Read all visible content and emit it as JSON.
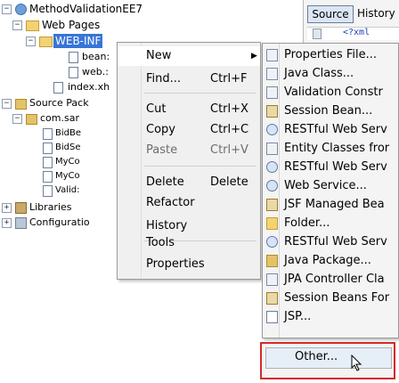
{
  "tree": {
    "project": "MethodValidationEE7",
    "web_pages": "Web Pages",
    "web_inf": "WEB-INF",
    "bean": "bean:",
    "web": "web.:",
    "index": "index.xh",
    "source_packages": "Source Pack",
    "com_package": "com.sar",
    "files": [
      "BidBe",
      "BidSe",
      "MyCo",
      "MyCo",
      "Valid:"
    ],
    "libraries": "Libraries",
    "configuration": "Configuratio"
  },
  "editor": {
    "tab_source": "Source",
    "tab_history": "History",
    "code_snippet": "<?xml"
  },
  "context_menu": {
    "items": [
      {
        "label": "New",
        "shortcut": "",
        "state": "highlighted",
        "submenu": true
      },
      {
        "label": "Find...",
        "shortcut": "Ctrl+F",
        "state": "normal"
      },
      {
        "label": "Cut",
        "shortcut": "Ctrl+X",
        "state": "normal"
      },
      {
        "label": "Copy",
        "shortcut": "Ctrl+C",
        "state": "normal"
      },
      {
        "label": "Paste",
        "shortcut": "Ctrl+V",
        "state": "disabled"
      },
      {
        "label": "Delete",
        "shortcut": "Delete",
        "state": "normal"
      },
      {
        "label": "Refactor",
        "shortcut": "",
        "state": "normal",
        "submenu": true
      },
      {
        "label": "History",
        "shortcut": "",
        "state": "normal",
        "submenu": true
      },
      {
        "label": "Tools",
        "shortcut": "",
        "state": "normal",
        "submenu": true
      },
      {
        "label": "Properties",
        "shortcut": "",
        "state": "normal"
      }
    ]
  },
  "new_submenu": {
    "items": [
      {
        "label": "Properties File...",
        "icon": "properties-file-icon"
      },
      {
        "label": "Java Class...",
        "icon": "java-class-icon"
      },
      {
        "label": "Validation Constr",
        "icon": "validation-icon"
      },
      {
        "label": "Session Bean...",
        "icon": "session-bean-icon"
      },
      {
        "label": "RESTful Web Serv",
        "icon": "web-service-icon"
      },
      {
        "label": "Entity Classes fror",
        "icon": "entity-class-icon"
      },
      {
        "label": "RESTful Web Serv",
        "icon": "web-service-icon"
      },
      {
        "label": "Web Service...",
        "icon": "web-service-icon"
      },
      {
        "label": "JSF Managed Bea",
        "icon": "managed-bean-icon"
      },
      {
        "label": "Folder...",
        "icon": "folder-icon"
      },
      {
        "label": "RESTful Web Serv",
        "icon": "web-service-icon"
      },
      {
        "label": "Java Package...",
        "icon": "java-package-icon"
      },
      {
        "label": "JPA Controller Cla",
        "icon": "jpa-controller-icon"
      },
      {
        "label": "Session Beans For",
        "icon": "session-bean-icon"
      },
      {
        "label": "JSP...",
        "icon": "jsp-file-icon"
      }
    ],
    "other_label": "Other...",
    "highlight_color": "#d42a2a"
  }
}
